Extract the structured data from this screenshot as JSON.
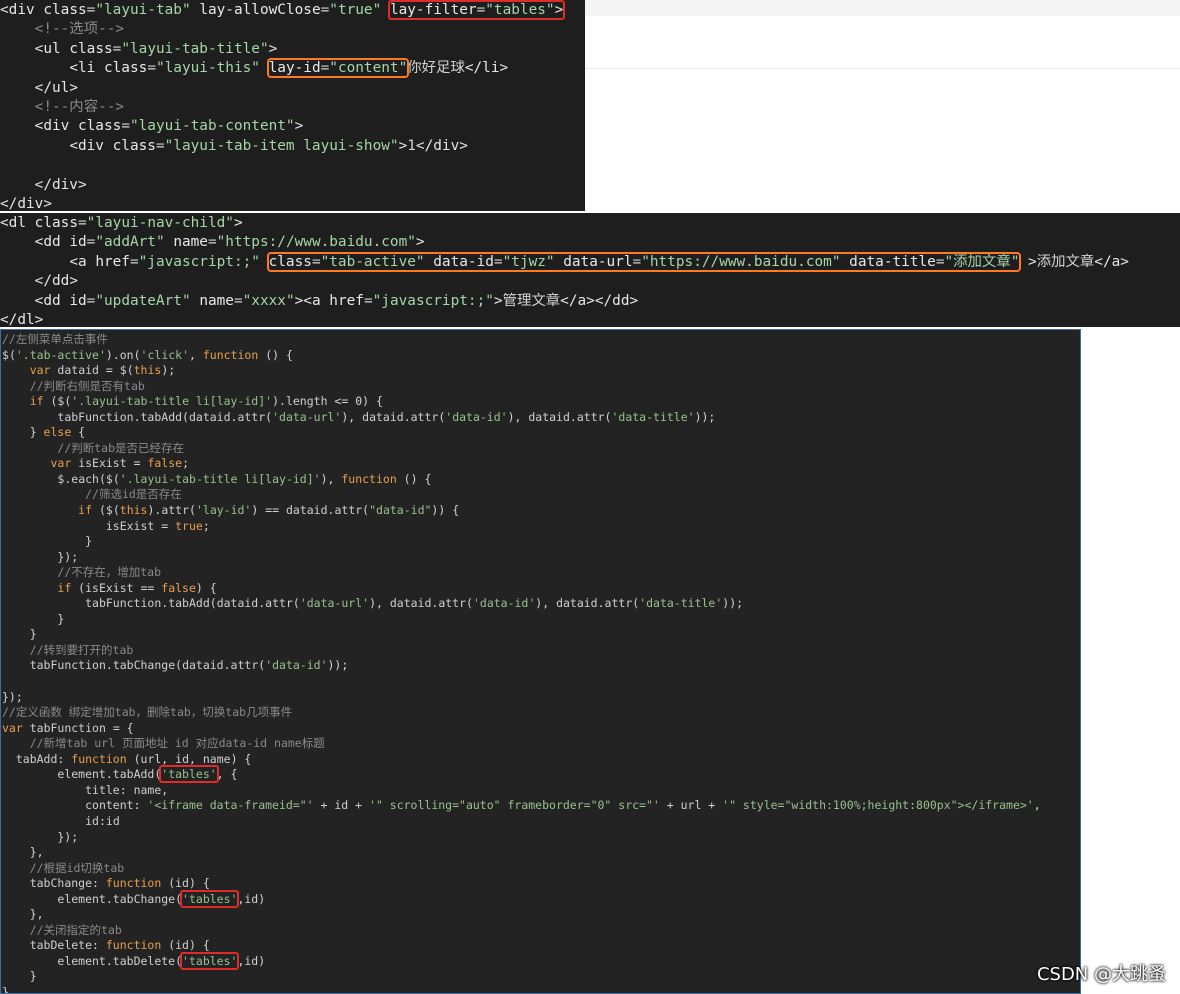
{
  "panel1": {
    "lines": [
      [
        "<div class=\"layui-tab\" lay-allowClose=\"true\" ",
        "lay-filter=\"tables\">"
      ],
      [
        "    <!--选项-->"
      ],
      [
        "    <ul class=\"layui-tab-title\">"
      ],
      [
        "        <li class=\"layui-this\" ",
        "lay-id=\"content\"",
        "你好足球</li>"
      ],
      [
        "    </ul>"
      ],
      [
        "    <!--内容-->"
      ],
      [
        "    <div class=\"layui-tab-content\">"
      ],
      [
        "        <div class=\"layui-tab-item layui-show\">1</div>"
      ],
      [
        ""
      ],
      [
        "    </div>"
      ],
      [
        "</div>"
      ]
    ]
  },
  "panel2": {
    "lines": [
      [
        "<dl class=\"layui-nav-child\">"
      ],
      [
        "    <dd id=\"addArt\" name=\"https://www.baidu.com\">"
      ],
      [
        "        <a href=\"javascript:;\" ",
        "class=\"tab-active\" data-id=\"tjwz\" data-url=\"https://www.baidu.com\" data-title=\"添加文章\"",
        " >添加文章</a>"
      ],
      [
        "    </dd>"
      ],
      [
        "    <dd id=\"updateArt\" name=\"xxxx\"><a href=\"javascript:;\">管理文章</a></dd>"
      ],
      [
        "</dl>"
      ]
    ]
  },
  "panel3": {
    "lines": [
      "//左侧菜单点击事件",
      "$('.tab-active').on('click', function () {",
      "    var dataid = $(this);",
      "    //判断右侧是否有tab",
      "    if ($('.layui-tab-title li[lay-id]').length <= 0) {",
      "        tabFunction.tabAdd(dataid.attr('data-url'), dataid.attr('data-id'), dataid.attr('data-title'));",
      "    } else {",
      "        //判断tab是否已经存在",
      "       var isExist = false;",
      "        $.each($('.layui-tab-title li[lay-id]'), function () {",
      "            //筛选id是否存在",
      "           if ($(this).attr('lay-id') == dataid.attr(\"data-id\")) {",
      "               isExist = true;",
      "            }",
      "        });",
      "        //不存在，增加tab",
      "        if (isExist == false) {",
      "            tabFunction.tabAdd(dataid.attr('data-url'), dataid.attr('data-id'), dataid.attr('data-title'));",
      "        }",
      "    }",
      "    //转到要打开的tab",
      "    tabFunction.tabChange(dataid.attr('data-id'));",
      "",
      "});",
      "//定义函数 绑定增加tab，删除tab，切换tab几项事件",
      "var tabFunction = {",
      "    //新增tab url 页面地址 id 对应data-id name标题",
      "  tabAdd: function (url, id, name) {",
      "        element.tabAdd('tables', {",
      "            title: name,",
      "            content: '<iframe data-frameid=\"' + id + '\" scrolling=\"auto\" frameborder=\"0\" src=\"' + url + '\" style=\"width:100%;height:800px\"></iframe>',",
      "            id:id",
      "        });",
      "    },",
      "    //根据id切换tab",
      "    tabChange: function (id) {",
      "        element.tabChange('tables',id)",
      "    },",
      "    //关闭指定的tab",
      "    tabDelete: function (id) {",
      "        element.tabDelete('tables',id)",
      "    }",
      "}"
    ],
    "highlight_token": "'tables'"
  },
  "watermark": "CSDN @大跳蚤",
  "colors": {
    "editor_bg": "#1e1e1e",
    "highlight_red": "#e02b2b",
    "highlight_orange": "#ff7a1a",
    "comment": "#8a8a8a",
    "keyword": "#e6a04c",
    "string": "#a5d6a7"
  }
}
